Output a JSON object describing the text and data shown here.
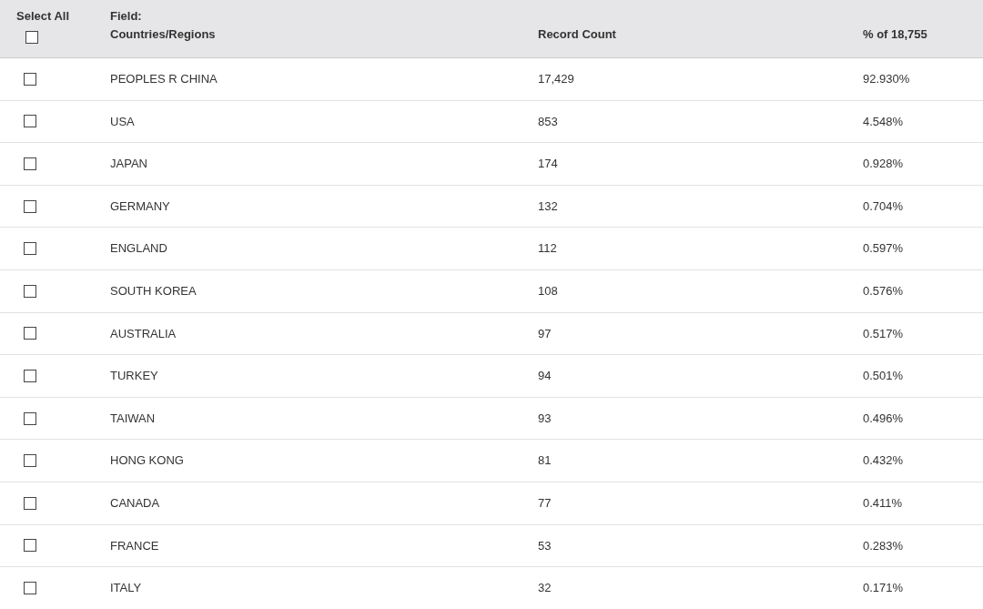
{
  "header": {
    "select_all": {
      "label": "Select All",
      "checked": false
    },
    "field_label": "Field:",
    "field_name": "Countries/Regions",
    "count_label": "Record Count",
    "percent_label": "% of 18,755"
  },
  "rows": [
    {
      "name": "PEOPLES R CHINA",
      "count": "17,429",
      "percent": "92.930%",
      "checked": false
    },
    {
      "name": "USA",
      "count": "853",
      "percent": "4.548%",
      "checked": false
    },
    {
      "name": "JAPAN",
      "count": "174",
      "percent": "0.928%",
      "checked": false
    },
    {
      "name": "GERMANY",
      "count": "132",
      "percent": "0.704%",
      "checked": false
    },
    {
      "name": "ENGLAND",
      "count": "112",
      "percent": "0.597%",
      "checked": false
    },
    {
      "name": "SOUTH KOREA",
      "count": "108",
      "percent": "0.576%",
      "checked": false
    },
    {
      "name": "AUSTRALIA",
      "count": "97",
      "percent": "0.517%",
      "checked": false
    },
    {
      "name": "TURKEY",
      "count": "94",
      "percent": "0.501%",
      "checked": false
    },
    {
      "name": "TAIWAN",
      "count": "93",
      "percent": "0.496%",
      "checked": false
    },
    {
      "name": "HONG KONG",
      "count": "81",
      "percent": "0.432%",
      "checked": false
    },
    {
      "name": "CANADA",
      "count": "77",
      "percent": "0.411%",
      "checked": false
    },
    {
      "name": "FRANCE",
      "count": "53",
      "percent": "0.283%",
      "checked": false
    },
    {
      "name": "ITALY",
      "count": "32",
      "percent": "0.171%",
      "checked": false
    }
  ]
}
